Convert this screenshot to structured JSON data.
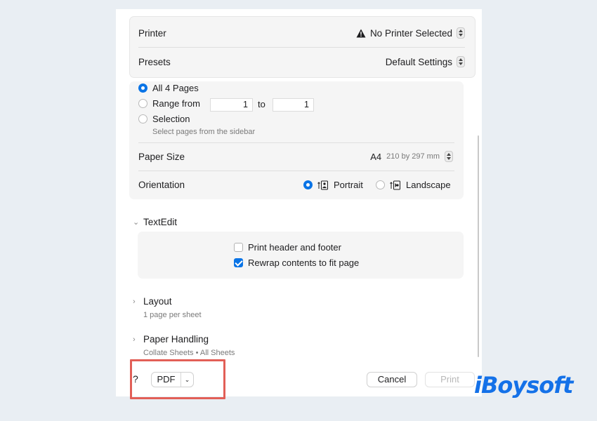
{
  "dialog": {
    "printer": {
      "label": "Printer",
      "value": "No Printer Selected"
    },
    "presets": {
      "label": "Presets",
      "value": "Default Settings"
    },
    "pages": {
      "all_label": "All 4 Pages",
      "range_label": "Range from",
      "range_from": "1",
      "range_to_label": "to",
      "range_to": "1",
      "selection_label": "Selection",
      "selection_hint": "Select pages from the sidebar"
    },
    "paper_size": {
      "label": "Paper Size",
      "value": "A4",
      "detail": "210 by 297 mm"
    },
    "orientation": {
      "label": "Orientation",
      "portrait": "Portrait",
      "landscape": "Landscape",
      "selected": "portrait"
    },
    "textedit": {
      "title": "TextEdit",
      "header_footer_label": "Print header and footer",
      "header_footer_checked": false,
      "rewrap_label": "Rewrap contents to fit page",
      "rewrap_checked": true
    },
    "layout": {
      "title": "Layout",
      "summary": "1 page per sheet"
    },
    "paper_handling": {
      "title": "Paper Handling",
      "summary": "Collate Sheets • All Sheets"
    },
    "footer": {
      "help": "?",
      "pdf": "PDF",
      "pdf_chevron": "⌄",
      "cancel": "Cancel",
      "print": "Print"
    }
  },
  "watermark": {
    "logo_text": "iBoysoft",
    "color": "#1471e8"
  },
  "colors": {
    "accent": "#0a74e6",
    "highlight": "#e25f57"
  }
}
